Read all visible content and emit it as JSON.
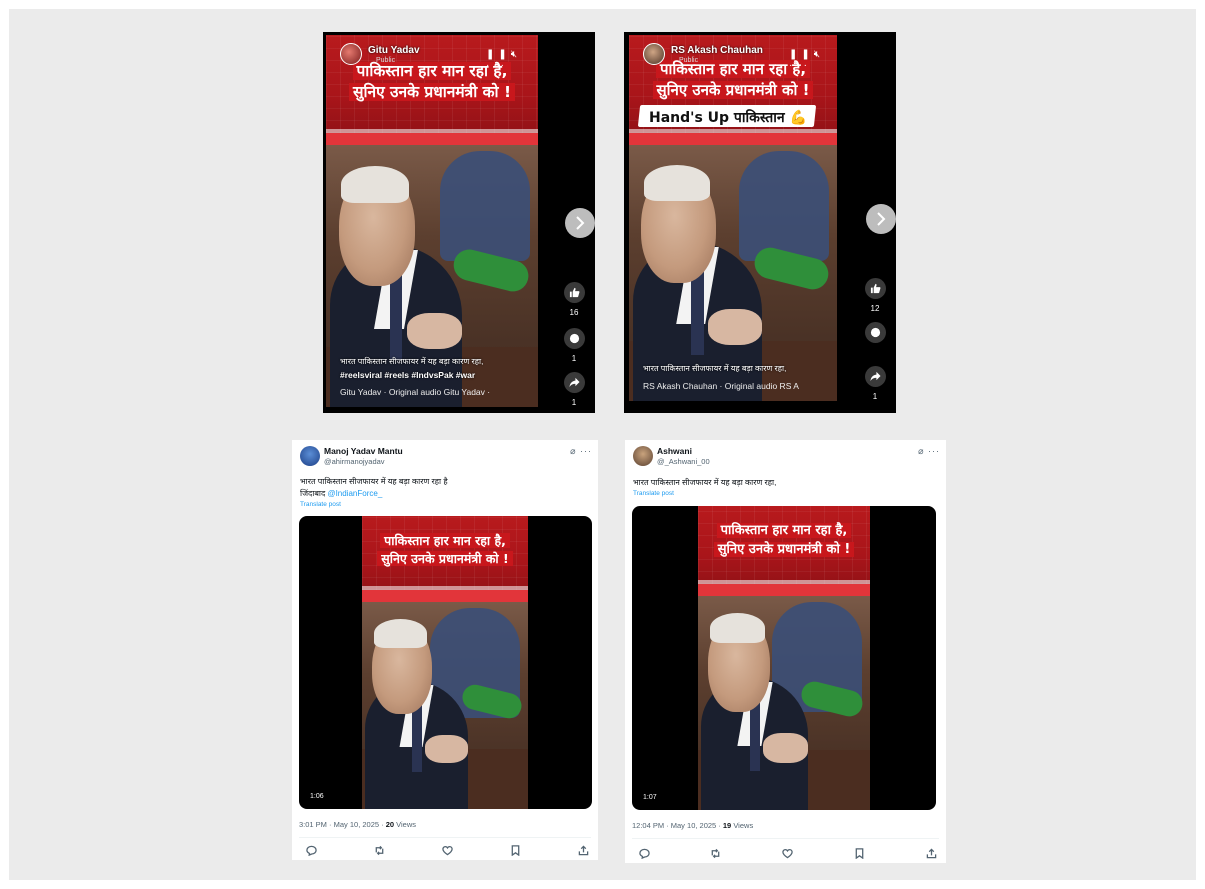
{
  "reels": [
    {
      "username": "Gitu Yadav",
      "audience": "Public",
      "headline_line1": "पाकिस्तान हार मान रहा है,",
      "headline_line2": "सुनिए उनके प्रधानमंत्री को !",
      "caption": "भारत पाकिस्तान सीजफायर में यह बड़ा कारण रहा,",
      "hashtags": "#reelsviral #reels #IndvsPak #war",
      "audio": "Gitu Yadav · Original audio     Gitu Yadav ·",
      "likes": "16",
      "comments": "1",
      "shares": "1"
    },
    {
      "username": "RS Akash Chauhan",
      "audience": "Public",
      "headline_line1": "पाकिस्तान हार मान रहा है,",
      "headline_line2": "सुनिए उनके प्रधानमंत्री को !",
      "overlay": "Hand's Up पाकिस्तान 💪",
      "caption": "भारत पाकिस्तान सीजफायर में यह बड़ा कारण रहा,",
      "audio": "RS Akash Chauhan · Original audio     RS A",
      "likes": "12",
      "shares": "1"
    }
  ],
  "tweets": [
    {
      "name": "Manoj Yadav Mantu",
      "handle": "@ahirmanojyadav",
      "text_line1": "भारत पाकिस्तान सीजफायर में यह बड़ा कारण रहा है",
      "text_line2_prefix": "जिंदाबाद ",
      "mention": "@IndianForce_",
      "translate": "Translate post",
      "headline_line1": "पाकिस्तान हार मान रहा है,",
      "headline_line2": "सुनिए उनके प्रधानमंत्री को !",
      "duration": "1:06",
      "time": "3:01 PM · May 10, 2025 · ",
      "views_count": "20",
      "views_label": " Views"
    },
    {
      "name": "Ashwani",
      "handle": "@_Ashwani_00",
      "text_line1": "भारत पाकिस्तान सीजफायर में यह बड़ा कारण रहा,",
      "translate": "Translate post",
      "headline_line1": "पाकिस्तान हार मान रहा है,",
      "headline_line2": "सुनिए उनके प्रधानमंत्री को !",
      "duration": "1:07",
      "time": "12:04 PM · May 10, 2025 · ",
      "views_count": "19",
      "views_label": " Views"
    }
  ],
  "icons": {
    "reel_controls": "pause-icon mute-icon more-icon",
    "side_actions": [
      "like-icon",
      "comment-icon",
      "share-icon"
    ],
    "tweet_actions": [
      "reply-icon",
      "retweet-icon",
      "like-icon",
      "bookmark-icon",
      "share-icon"
    ]
  },
  "colors": {
    "news_red": "#b81a1d",
    "link_blue": "#1d9bf0",
    "page_bg": "#ebebeb"
  }
}
